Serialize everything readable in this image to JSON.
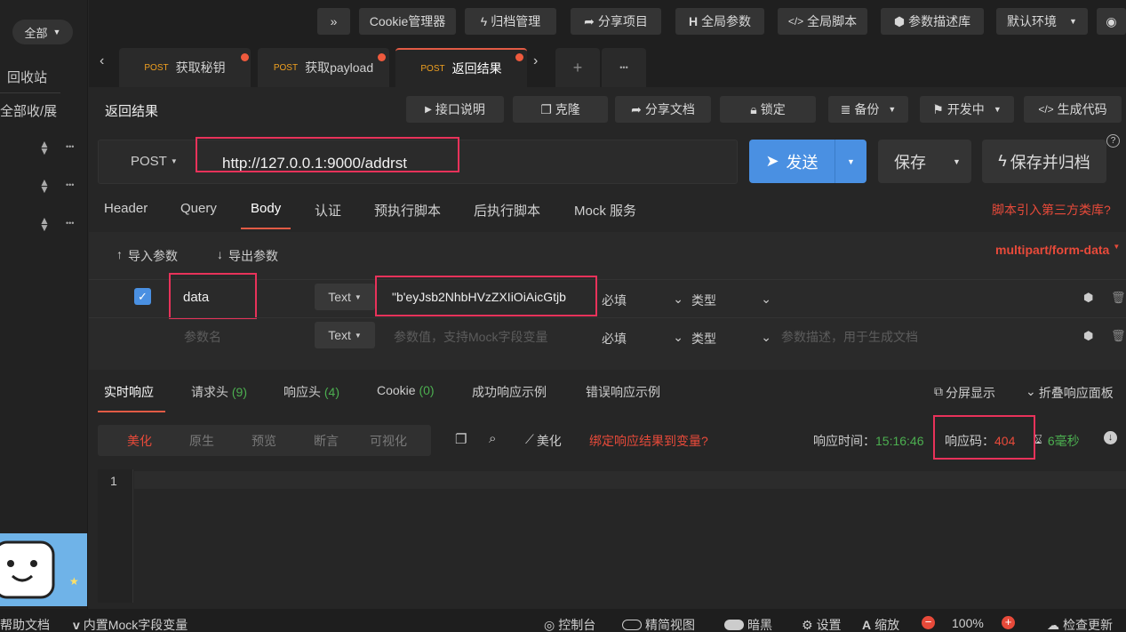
{
  "sidebar": {
    "filter_label": "全部",
    "recycle_label": "回收站",
    "collapse_label": "全部收/展",
    "more_glyph": "•••"
  },
  "topbar": {
    "expand_glyph": "»",
    "cookie_manager": "Cookie管理器",
    "archive_manage": "归档管理",
    "share_project": "分享项目",
    "global_params": "全局参数",
    "global_script": "全局脚本",
    "param_desc_lib": "参数描述库",
    "default_env": "默认环境"
  },
  "tabs": [
    {
      "method": "POST",
      "label": "获取秘钥"
    },
    {
      "method": "POST",
      "label": "获取payload"
    },
    {
      "method": "POST",
      "label": "返回结果"
    }
  ],
  "toolbar": {
    "title": "返回结果",
    "api_doc": "接口说明",
    "clone": "克隆",
    "share_doc": "分享文档",
    "lock": "锁定",
    "backup": "备份",
    "dev_status": "开发中",
    "gen_code": "生成代码"
  },
  "request": {
    "method": "POST",
    "url": "http://127.0.0.1:9000/addrst",
    "send": "发送",
    "save": "保存",
    "save_archive": "保存并归档",
    "help_glyph": "?"
  },
  "req_tabs": [
    "Header",
    "Query",
    "Body",
    "认证",
    "预执行脚本",
    "后执行脚本",
    "Mock 服务"
  ],
  "third_party_link": "脚本引入第三方类库?",
  "body": {
    "import_label": "导入参数",
    "export_label": "导出参数",
    "content_type": "multipart/form-data",
    "rows": [
      {
        "key": "data",
        "type": "Text",
        "value": "\"b'eyJsb2NhbHVzZXIiOiAicGtjb",
        "required": "必填",
        "kind": "类型",
        "desc": ""
      },
      {
        "key_placeholder": "参数名",
        "type": "Text",
        "value_placeholder": "参数值，支持Mock字段变量",
        "required": "必填",
        "kind": "类型",
        "desc_placeholder": "参数描述，用于生成文档"
      }
    ]
  },
  "resp_tabs": {
    "realtime": "实时响应",
    "req_headers": "请求头",
    "req_headers_count": "(9)",
    "resp_headers": "响应头",
    "resp_headers_count": "(4)",
    "cookie": "Cookie",
    "cookie_count": "(0)",
    "success_example": "成功响应示例",
    "error_example": "错误响应示例",
    "split_view": "分屏显示",
    "fold_panel": "折叠响应面板"
  },
  "view_modes": [
    "美化",
    "原生",
    "预览",
    "断言",
    "可视化"
  ],
  "resp_tools": {
    "beautify": "美化",
    "bind_var": "绑定响应结果到变量?",
    "time_label": "响应时间：",
    "time_value": "15:16:46",
    "code_label": "响应码：",
    "code_value": "404",
    "duration": "6毫秒"
  },
  "editor": {
    "line_number": "1"
  },
  "statusbar": {
    "help_doc": "帮助文档",
    "mock_vars": "内置Mock字段变量",
    "console": "控制台",
    "compact_view": "精简视图",
    "dark": "暗黑",
    "settings": "设置",
    "zoom": "缩放",
    "zoom_value": "100%",
    "check_update": "检查更新"
  },
  "colors": {
    "accent_blue": "#4a90e2",
    "highlight_red": "#e8325a",
    "status_green": "#4caf50",
    "link_red": "#e84a3a"
  }
}
